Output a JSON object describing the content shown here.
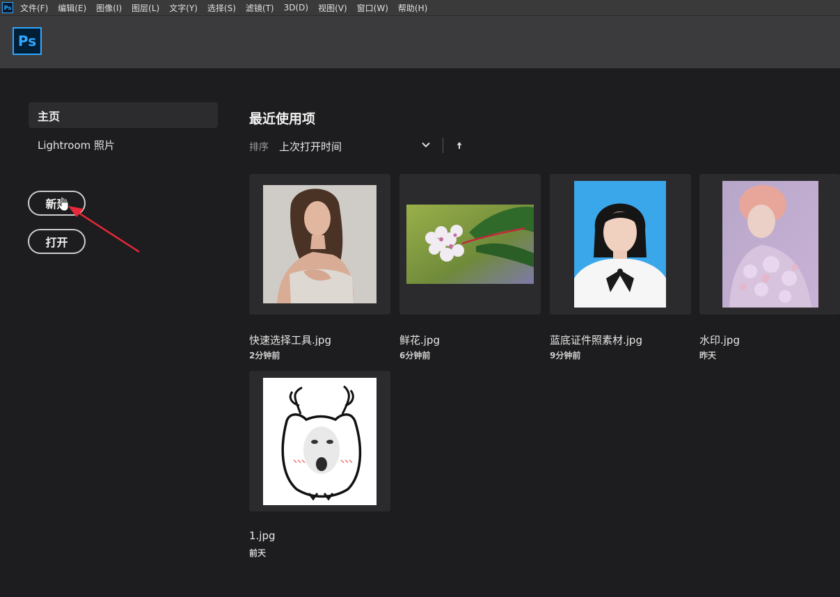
{
  "app": {
    "icon_label": "Ps",
    "logo_label": "Ps"
  },
  "menu": [
    "文件(F)",
    "编辑(E)",
    "图像(I)",
    "图层(L)",
    "文字(Y)",
    "选择(S)",
    "滤镜(T)",
    "3D(D)",
    "视图(V)",
    "窗口(W)",
    "帮助(H)"
  ],
  "sidebar": {
    "home_label": "主页",
    "lightroom_label": "Lightroom 照片",
    "new_label": "新建",
    "open_label": "打开"
  },
  "recent": {
    "title": "最近使用项",
    "sort_label": "排序",
    "sort_value": "上次打开时间",
    "files": [
      {
        "name": "快速选择工具.jpg",
        "time": "2分钟前"
      },
      {
        "name": "鲜花.jpg",
        "time": "6分钟前"
      },
      {
        "name": "蓝底证件照素材.jpg",
        "time": "9分钟前"
      },
      {
        "name": "水印.jpg",
        "time": "昨天"
      },
      {
        "name": "1.jpg",
        "time": "前天"
      }
    ]
  },
  "colors": {
    "accent": "#31a8ff",
    "annotation_arrow": "#e8283a",
    "background": "#1d1c1e",
    "card": "#2b2a2d"
  }
}
